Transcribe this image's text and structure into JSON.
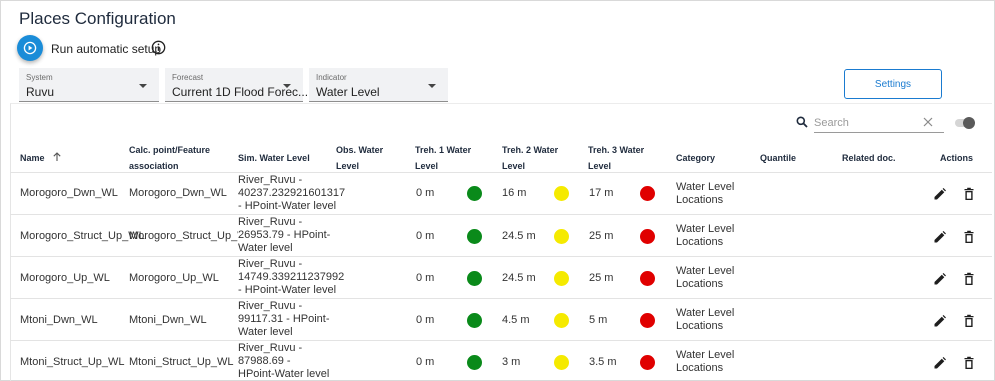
{
  "page": {
    "title": "Places Configuration"
  },
  "toolbar": {
    "run_label": "Run automatic setup"
  },
  "filters": [
    {
      "label": "System",
      "value": "Ruvu"
    },
    {
      "label": "Forecast",
      "value": "Current 1D Flood Forec..."
    },
    {
      "label": "Indicator",
      "value": "Water Level"
    }
  ],
  "settings_label": "Settings",
  "search": {
    "placeholder": "Search"
  },
  "colors": {
    "green": "#0a8a1a",
    "yellow": "#f5ea00",
    "red": "#e00000",
    "accent": "#1a7bd0"
  },
  "table": {
    "headers": {
      "name": "Name",
      "calc": "Calc. point/Feature association",
      "sim": "Sim. Water Level",
      "obs": "Obs. Water Level",
      "t1": "Treh. 1 Water Level",
      "t2": "Treh. 2 Water Level",
      "t3": "Treh. 3 Water Level",
      "category": "Category",
      "quantile": "Quantile",
      "related": "Related doc.",
      "actions": "Actions"
    },
    "rows": [
      {
        "name": "Morogoro_Dwn_WL",
        "calc": "Morogoro_Dwn_WL",
        "sim": "River_Ruvu - 40237.232921601317 - HPoint-Water level",
        "t1": "0 m",
        "t2": "16 m",
        "t3": "17 m",
        "category": "Water Level Locations"
      },
      {
        "name": "Morogoro_Struct_Up_WL",
        "calc": "Morogoro_Struct_Up_WL",
        "sim": "River_Ruvu - 26953.79 - HPoint-Water level",
        "t1": "0 m",
        "t2": "24.5 m",
        "t3": "25 m",
        "category": "Water Level Locations"
      },
      {
        "name": "Morogoro_Up_WL",
        "calc": "Morogoro_Up_WL",
        "sim": "River_Ruvu - 14749.339211237992 - HPoint-Water level",
        "t1": "0 m",
        "t2": "24.5 m",
        "t3": "25 m",
        "category": "Water Level Locations"
      },
      {
        "name": "Mtoni_Dwn_WL",
        "calc": "Mtoni_Dwn_WL",
        "sim": "River_Ruvu - 99117.31 - HPoint-Water level",
        "t1": "0 m",
        "t2": "4.5 m",
        "t3": "5 m",
        "category": "Water Level Locations"
      },
      {
        "name": "Mtoni_Struct_Up_WL",
        "calc": "Mtoni_Struct_Up_WL",
        "sim": "River_Ruvu - 87988.69 - HPoint-Water level",
        "t1": "0 m",
        "t2": "3 m",
        "t3": "3.5 m",
        "category": "Water Level Locations"
      }
    ]
  }
}
